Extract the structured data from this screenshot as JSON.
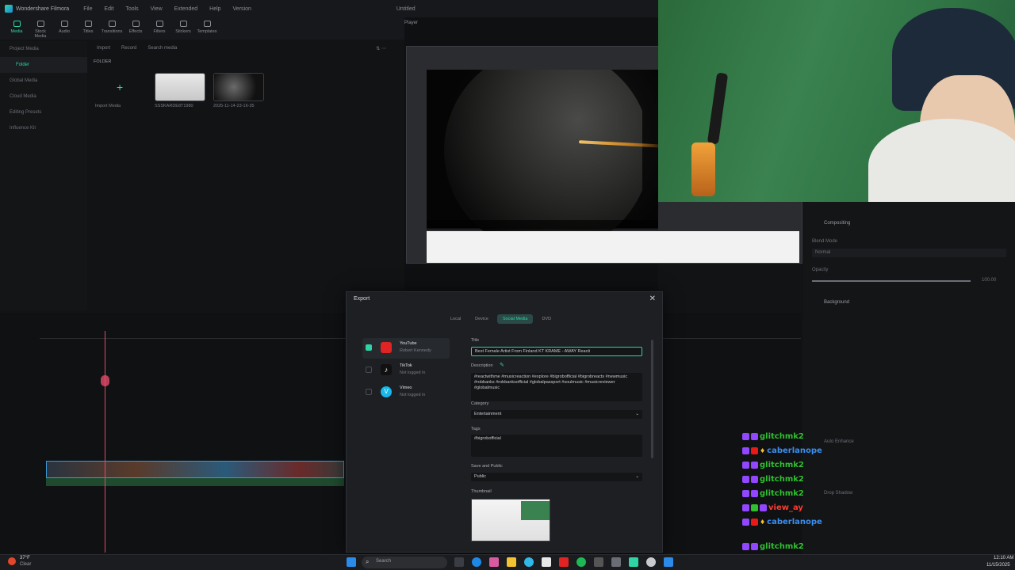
{
  "app": {
    "name": "Wondershare Filmora",
    "menu": [
      "File",
      "Edit",
      "Tools",
      "View",
      "Extended",
      "Help",
      "Version"
    ],
    "doc_title": "Untitled"
  },
  "toolbar": [
    "Media",
    "Stock Media",
    "Audio",
    "Titles",
    "Transitions",
    "Effects",
    "Filters",
    "Stickers",
    "Templates"
  ],
  "sidebar": [
    "Project Media",
    "Folder",
    "Global Media",
    "Cloud Media",
    "Editing Presets",
    "Influence Kit"
  ],
  "media": {
    "import": "Import",
    "record": "Record",
    "search_placeholder": "Search media",
    "folder": "FOLDER",
    "items": [
      "Import Media",
      "SSSKARDE8T1980",
      "2025-11-14-23-16-35"
    ]
  },
  "player": {
    "label": "Player"
  },
  "properties": {
    "compositing": "Compositing",
    "blend_mode_label": "Blend Mode",
    "blend_mode_value": "Normal",
    "opacity_label": "Opacity",
    "opacity_value": "100.00",
    "background": "Background",
    "auto_enhance": "Auto Enhance",
    "drop_shadow": "Drop Shadow"
  },
  "export": {
    "title": "Export",
    "tabs": [
      "Local",
      "Device",
      "Social Media",
      "DVD"
    ],
    "active_tab": "Social Media",
    "platforms": [
      {
        "name": "YouTube",
        "status": "Robert Kennedy",
        "checked": true,
        "color": "#e02424"
      },
      {
        "name": "TikTok",
        "status": "Not logged in",
        "checked": false,
        "color": "#111111"
      },
      {
        "name": "Vimeo",
        "status": "Not logged in",
        "checked": false,
        "color": "#19b7ea"
      }
    ],
    "title_label": "Title",
    "title_value": "Best Female Artist From Finland KT KRAME - AWAY Reacti",
    "description_label": "Description",
    "description_value": "#reactwithme #musicreaction #explore #bigrobofficial #bigrobreacts #newmusic #robbanks #robbanksofficial #globalpassport #soulmusic #musicreviewer #globalmusic",
    "category_label": "Category",
    "category_value": "Entertainment",
    "tags_label": "Tags",
    "tags_value": "#bigrobofficial",
    "save_label": "Save and Public",
    "save_value": "Public",
    "thumbnail_label": "Thumbnail"
  },
  "chat": [
    {
      "user": "glitchmk2",
      "color": "#2fbf2f"
    },
    {
      "user": "caberlanope",
      "color": "#3a8ff0"
    },
    {
      "user": "glitchmk2",
      "color": "#2fbf2f"
    },
    {
      "user": "glitchmk2",
      "color": "#2fbf2f"
    },
    {
      "user": "glitchmk2",
      "color": "#2fbf2f"
    },
    {
      "user": "view_ay",
      "color": "#ff3b2f"
    },
    {
      "user": "caberlanope",
      "color": "#3a8ff0"
    },
    {
      "user": "glitchmk2",
      "color": "#2fbf2f"
    },
    {
      "user": "glitchmk2",
      "color": "#2fbf2f"
    }
  ],
  "taskbar": {
    "weather_temp": "37°F",
    "weather_desc": "Clear",
    "search": "Search",
    "time": "12:10 AM",
    "date": "11/15/2025"
  }
}
